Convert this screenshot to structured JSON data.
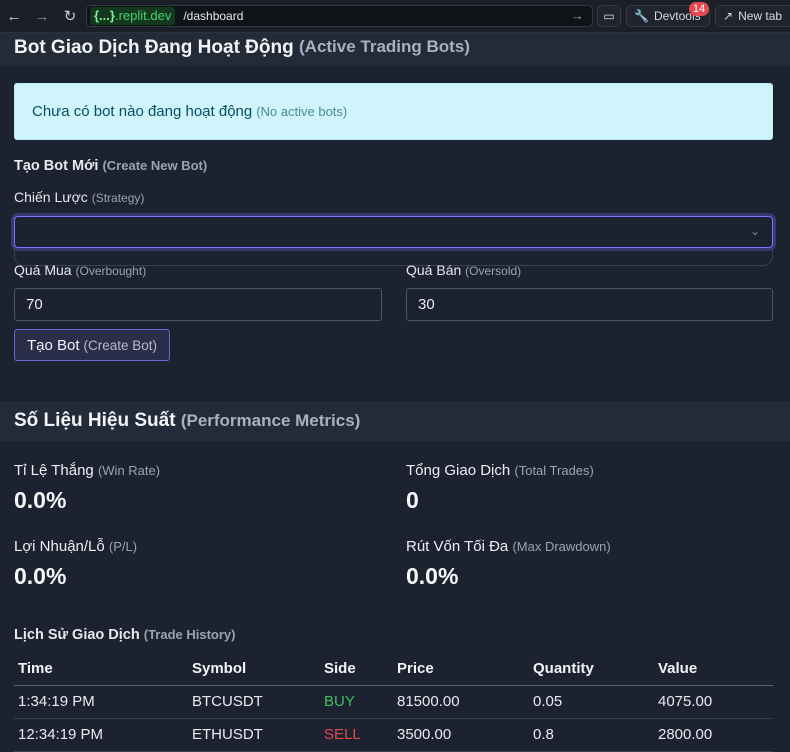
{
  "browser": {
    "host": ".replit.dev",
    "host_braces": "{...}",
    "path": "/dashboard",
    "devtools_label": "Devtools",
    "devtools_badge": "14",
    "newtab_label": "New tab"
  },
  "active_bots": {
    "title": "Bot Giao Dịch Đang Hoạt Động",
    "title_en": "(Active Trading Bots)",
    "empty_text": "Chưa có bot nào đang hoạt động",
    "empty_text_en": "(No active bots)"
  },
  "create_bot": {
    "title": "Tạo Bot Mới",
    "title_en": "(Create New Bot)",
    "strategy_label": "Chiến Lược",
    "strategy_label_en": "(Strategy)",
    "strategy_value": "",
    "overbought_label": "Quá Mua",
    "overbought_label_en": "(Overbought)",
    "overbought_value": "70",
    "oversold_label": "Quá Bán",
    "oversold_label_en": "(Oversold)",
    "oversold_value": "30",
    "button_label": "Tạo Bot",
    "button_label_en": "(Create Bot)"
  },
  "performance": {
    "title": "Số Liệu Hiệu Suất",
    "title_en": "(Performance Metrics)",
    "win_rate_label": "Tỉ Lệ Thắng",
    "win_rate_label_en": "(Win Rate)",
    "win_rate_value": "0.0%",
    "total_trades_label": "Tổng Giao Dịch",
    "total_trades_label_en": "(Total Trades)",
    "total_trades_value": "0",
    "pl_label": "Lợi Nhuận/Lỗ",
    "pl_label_en": "(P/L)",
    "pl_value": "0.0%",
    "drawdown_label": "Rút Vốn Tối Đa",
    "drawdown_label_en": "(Max Drawdown)",
    "drawdown_value": "0.0%"
  },
  "history": {
    "title": "Lịch Sử Giao Dịch",
    "title_en": "(Trade History)",
    "columns": [
      "Time",
      "Symbol",
      "Side",
      "Price",
      "Quantity",
      "Value"
    ],
    "rows": [
      [
        "1:34:19 PM",
        "BTCUSDT",
        "BUY",
        "81500.00",
        "0.05",
        "4075.00"
      ],
      [
        "12:34:19 PM",
        "ETHUSDT",
        "SELL",
        "3500.00",
        "0.8",
        "2800.00"
      ]
    ]
  },
  "colors": {
    "buy": "#3fbf5f",
    "sell": "#e5484d",
    "accent": "#7b74ff",
    "info_bg": "#cff4fc"
  }
}
